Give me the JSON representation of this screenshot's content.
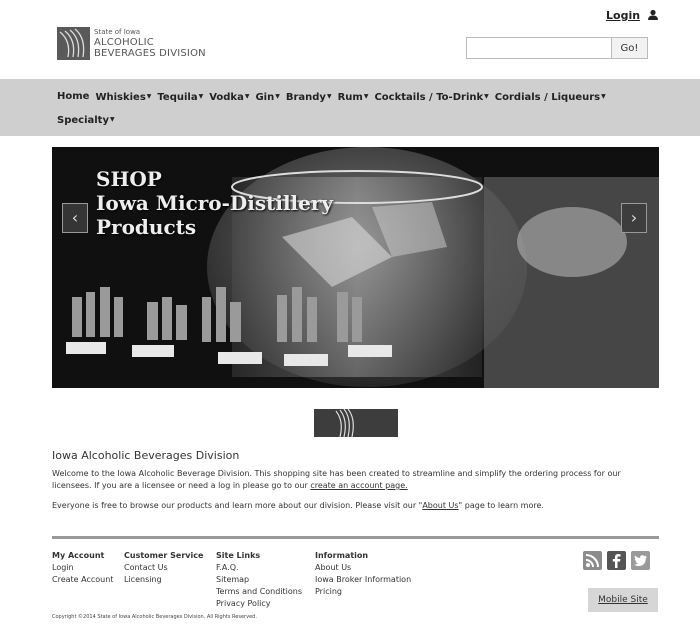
{
  "header": {
    "login_label": "Login",
    "logo": {
      "line1": "State of Iowa",
      "line2": "ALCOHOLIC",
      "line3": "BEVERAGES DIVISION"
    },
    "search": {
      "placeholder": "",
      "value": "",
      "button_label": "Go!"
    }
  },
  "nav": {
    "items": [
      {
        "label": "Home",
        "dropdown": false
      },
      {
        "label": "Whiskies",
        "dropdown": true
      },
      {
        "label": "Tequila",
        "dropdown": true
      },
      {
        "label": "Vodka",
        "dropdown": true
      },
      {
        "label": "Gin",
        "dropdown": true
      },
      {
        "label": "Brandy",
        "dropdown": true
      },
      {
        "label": "Rum",
        "dropdown": true
      },
      {
        "label": "Cocktails / To-Drink",
        "dropdown": true
      },
      {
        "label": "Cordials / Liqueurs",
        "dropdown": true
      },
      {
        "label": "Specialty",
        "dropdown": true
      }
    ],
    "caret_glyph": "▼"
  },
  "carousel": {
    "heading_line1": "SHOP",
    "heading_line2": "Iowa Micro-Distillery",
    "heading_line3": "Products",
    "prev_glyph": "‹",
    "next_glyph": "›"
  },
  "main": {
    "title": "Iowa Alcoholic Beverages Division",
    "intro_text": "Welcome to the Iowa Alcoholic Beverage Division. This shopping site has been created to streamline and simplify the ordering process for our licensees. If you are a licensee or need a log in please go to our",
    "create_account_link": "create an account page.",
    "browse_text_before": "Everyone is free to browse our products and learn more about our division. Please visit our \"",
    "about_link": "About Us",
    "browse_text_after": "\" page to learn more."
  },
  "footer": {
    "account": {
      "heading": "My Account",
      "links": [
        "Login",
        "Create Account"
      ]
    },
    "service": {
      "heading": "Customer Service",
      "links": [
        "Contact Us",
        "Licensing"
      ]
    },
    "site_links": {
      "heading": "Site Links",
      "links": [
        "F.A.Q.",
        "Sitemap",
        "Terms and Conditions",
        "Privacy Policy"
      ]
    },
    "information": {
      "heading": "Information",
      "links": [
        "About Us",
        "Iowa Broker Information",
        "Pricing"
      ]
    },
    "social_icons": [
      "rss-icon",
      "facebook-icon",
      "twitter-icon"
    ],
    "mobile_site_label": "Mobile Site",
    "copyright": "Copyright ©2014 State of Iowa Alcoholic Beverages Division. All Rights Reserved."
  }
}
